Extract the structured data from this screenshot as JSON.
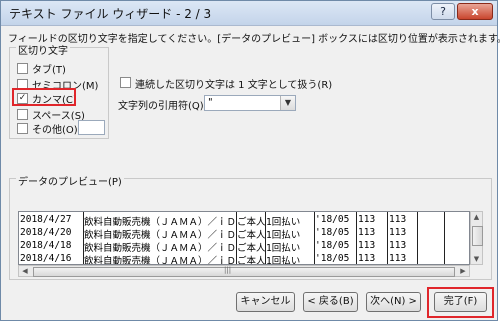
{
  "window": {
    "title": "テキスト ファイル ウィザード - 2 / 3",
    "help_icon": "?",
    "close_icon": "x"
  },
  "description": "フィールドの区切り文字を指定してください。[データのプレビュー] ボックスには区切り位置が表示されます。",
  "delimiters": {
    "group_label": "区切り文字",
    "items": [
      {
        "label": "タブ(T)",
        "checked": false,
        "mark": ""
      },
      {
        "label": "セミコロン(M)",
        "checked": false,
        "mark": ""
      },
      {
        "label": "カンマ(C)",
        "checked": true,
        "mark": "✓"
      },
      {
        "label": "スペース(S)",
        "checked": false,
        "mark": ""
      },
      {
        "label": "その他(O):",
        "checked": false,
        "mark": ""
      }
    ]
  },
  "options": {
    "consecutive_label": "連続した区切り文字は 1 文字として扱う(R)",
    "text_qualifier_label": "文字列の引用符(Q):",
    "text_qualifier_value": "\""
  },
  "preview": {
    "label": "データのプレビュー(P)",
    "rows": [
      [
        "2018/4/27",
        "飲料自動販売機（ＪＡＭＡ）／ｉＤ",
        "ご本人",
        "1回払い",
        "'18/05",
        "113",
        "113"
      ],
      [
        "2018/4/20",
        "飲料自動販売機（ＪＡＭＡ）／ｉＤ",
        "ご本人",
        "1回払い",
        "'18/05",
        "113",
        "113"
      ],
      [
        "2018/4/18",
        "飲料自動販売機（ＪＡＭＡ）／ｉＤ",
        "ご本人",
        "1回払い",
        "'18/05",
        "113",
        "113"
      ],
      [
        "2018/4/16",
        "飲料自動販売機（ＪＡＭＡ）／ｉＤ",
        "ご本人",
        "1回払い",
        "'18/05",
        "113",
        "113"
      ]
    ]
  },
  "buttons": {
    "cancel": "キャンセル",
    "back": "< 戻る(B)",
    "next": "次へ(N) >",
    "finish": "完了(F)"
  },
  "colors": {
    "highlight": "#e0262b"
  }
}
